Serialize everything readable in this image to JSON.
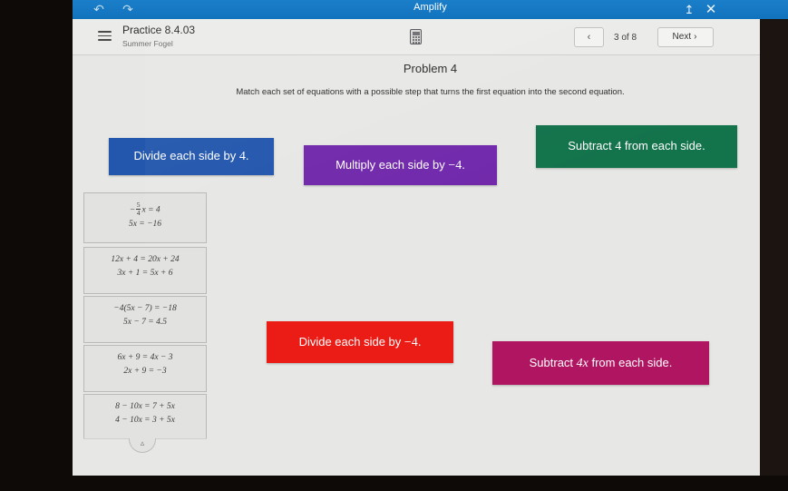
{
  "topbar": {
    "app_title": "Amplify",
    "back_icon": "back-arrow-icon",
    "forward_icon": "forward-arrow-icon",
    "share_icon": "share-icon",
    "close_icon": "close-icon",
    "background_color": "#1779c4"
  },
  "header": {
    "menu_icon": "hamburger-menu-icon",
    "assignment_title": "Practice 8.4.03",
    "student_name": "Summer Fogel",
    "calculator_icon": "calculator-icon",
    "pager": {
      "prev_label": "‹",
      "count_label": "3 of 8",
      "next_label": "Next",
      "next_chevron": "›"
    }
  },
  "problem": {
    "title": "Problem 4",
    "prompt": "Match each set of equations with a possible step that turns the first equation into the second equation."
  },
  "equation_cards": [
    {
      "name": "equation-card-1",
      "line1_prefix": "−",
      "line1_frac_num": "5",
      "line1_frac_den": "4",
      "line1_suffix": "x = 4",
      "line2": "5x = −16"
    },
    {
      "name": "equation-card-2",
      "line1": "12x + 4 = 20x + 24",
      "line2": "3x + 1 = 5x + 6"
    },
    {
      "name": "equation-card-3",
      "line1": "−4(5x − 7) = −18",
      "line2": "5x − 7 = 4.5"
    },
    {
      "name": "equation-card-4",
      "line1": "6x + 9 = 4x − 3",
      "line2": "2x + 9 = −3"
    },
    {
      "name": "equation-card-5",
      "line1": "8 − 10x = 7 + 5x",
      "line2": "4 − 10x = 3 + 5x"
    }
  ],
  "collapse": {
    "icon": "chevron-up-icon"
  },
  "choices": [
    {
      "name": "choice-divide-by-4",
      "text_before": "Divide each side by ",
      "math": "4",
      "text_after": ".",
      "color": "#2357ad"
    },
    {
      "name": "choice-multiply-by-negative-4",
      "text_before": "Multiply each side by ",
      "math": "−4",
      "text_after": ".",
      "color": "#7129ab"
    },
    {
      "name": "choice-subtract-4",
      "text_before": "Subtract ",
      "math": "4",
      "text_after": " from each side.",
      "color": "#13734b"
    },
    {
      "name": "choice-divide-by-negative-4",
      "text_before": "Divide each side by ",
      "math": "−4",
      "text_after": ".",
      "color": "#eb1c16"
    },
    {
      "name": "choice-subtract-4x",
      "text_before": "Subtract ",
      "math": "4x",
      "text_after": " from each side.",
      "color": "#b01561"
    }
  ]
}
